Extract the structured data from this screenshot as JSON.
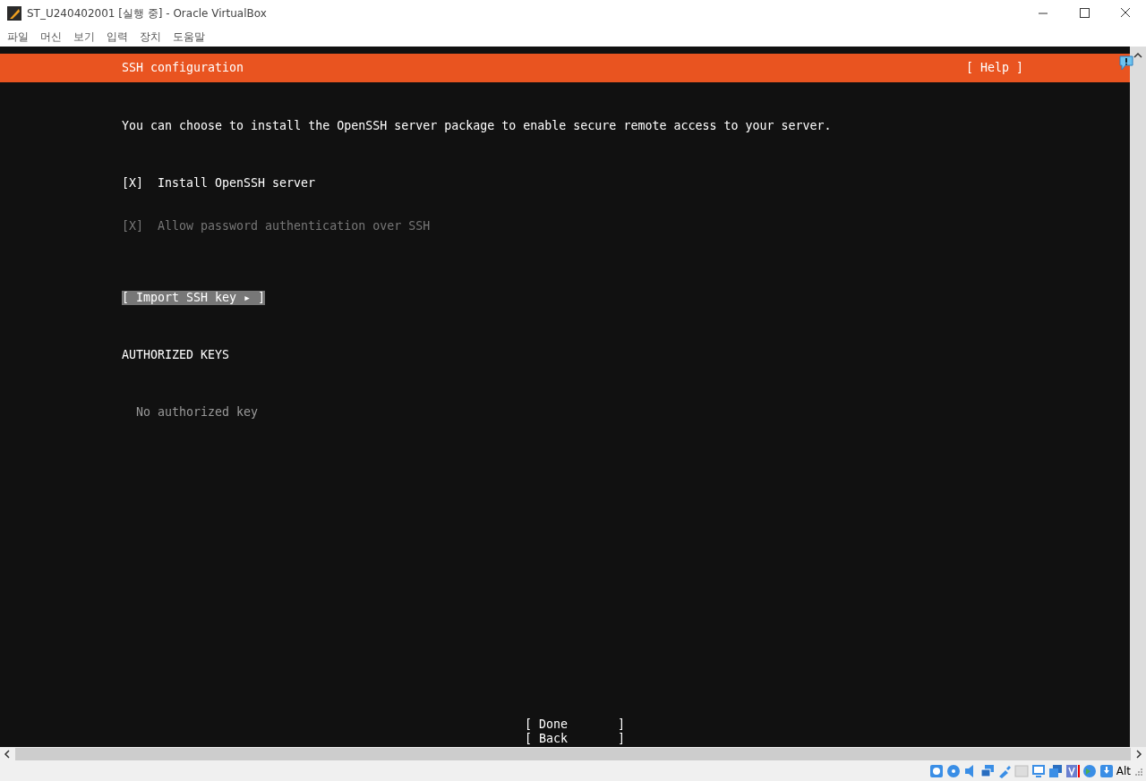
{
  "window": {
    "title": "ST_U240402001 [실행 중] - Oracle VirtualBox"
  },
  "menu": [
    "파일",
    "머신",
    "보기",
    "입력",
    "장치",
    "도움말"
  ],
  "installer": {
    "header": {
      "title": "SSH configuration",
      "help": "[ Help ]"
    },
    "description": "You can choose to install the OpenSSH server package to enable secure remote access to your server.",
    "options": [
      {
        "mark": "[X]",
        "label": "Install OpenSSH server",
        "checked": true,
        "disabled": false
      },
      {
        "mark": "[X]",
        "label": "Allow password authentication over SSH",
        "checked": true,
        "disabled": true
      }
    ],
    "import_button": {
      "label": "[ Import SSH key ▸ ]",
      "selected": true
    },
    "section_title": "AUTHORIZED KEYS",
    "empty_text": "No authorized key",
    "buttons": [
      {
        "label": "[ Done       ]",
        "selected": false
      },
      {
        "label": "[ Back       ]",
        "selected": false
      }
    ]
  },
  "status_bar": {
    "key": "Alt"
  }
}
